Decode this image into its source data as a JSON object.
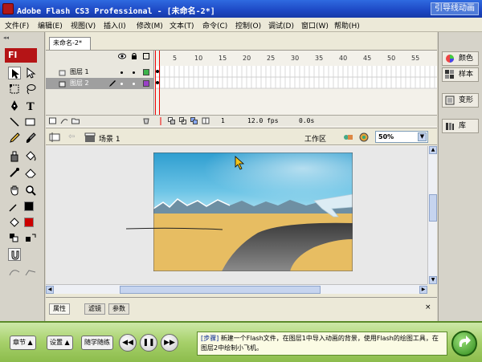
{
  "window": {
    "title": "Adobe Flash CS3 Professional - [未命名-2*]",
    "badge": "引导线动画"
  },
  "menu": [
    "文件(F)",
    "编辑(E)",
    "视图(V)",
    "插入(I)",
    "修改(M)",
    "文本(T)",
    "命令(C)",
    "控制(O)",
    "调试(D)",
    "窗口(W)",
    "帮助(H)"
  ],
  "tools": {
    "logo": "Fl",
    "items": [
      "selection-tool",
      "subselection-tool",
      "free-transform-tool",
      "lasso-tool",
      "pen-tool",
      "text-tool",
      "line-tool",
      "rectangle-tool",
      "pencil-tool",
      "brush-tool",
      "ink-bottle-tool",
      "paint-bucket-tool",
      "eyedropper-tool",
      "eraser-tool",
      "hand-tool",
      "zoom-tool"
    ],
    "stroke_color": "#000000",
    "fill_color": "#cc0000"
  },
  "right_panel": {
    "buttons": [
      "颜色",
      "样本",
      "变形",
      "库"
    ]
  },
  "document": {
    "tab": "未命名-2*"
  },
  "timeline": {
    "frame_numbers": [
      "5",
      "10",
      "15",
      "20",
      "25",
      "30",
      "35",
      "40",
      "45",
      "50",
      "55"
    ],
    "layers": [
      {
        "name": "图层 1",
        "color": "#3cb44a",
        "active": false
      },
      {
        "name": "图层 2",
        "color": "#9a40c8",
        "active": true
      }
    ],
    "current_frame": "1",
    "fps": "12.0 fps",
    "time": "0.0s"
  },
  "editbar": {
    "scene": "场景 1",
    "workspace": "工作区",
    "zoom": "50%"
  },
  "properties": {
    "tabs": [
      "属性",
      "滤镜",
      "参数"
    ]
  },
  "player": {
    "buttons": [
      "章节",
      "设置",
      "随学随练"
    ],
    "info_tag": "[步骤]",
    "info_text": "新建一个Flash文件，在图层1中导入动画的背景，使用Flash的绘图工具，在图层2中绘制小飞机。"
  },
  "colors": {
    "titlebar": "#1d48c4",
    "sky": "#3aaed0",
    "sand": "#e7bd62",
    "road": "#4a4a4a"
  }
}
